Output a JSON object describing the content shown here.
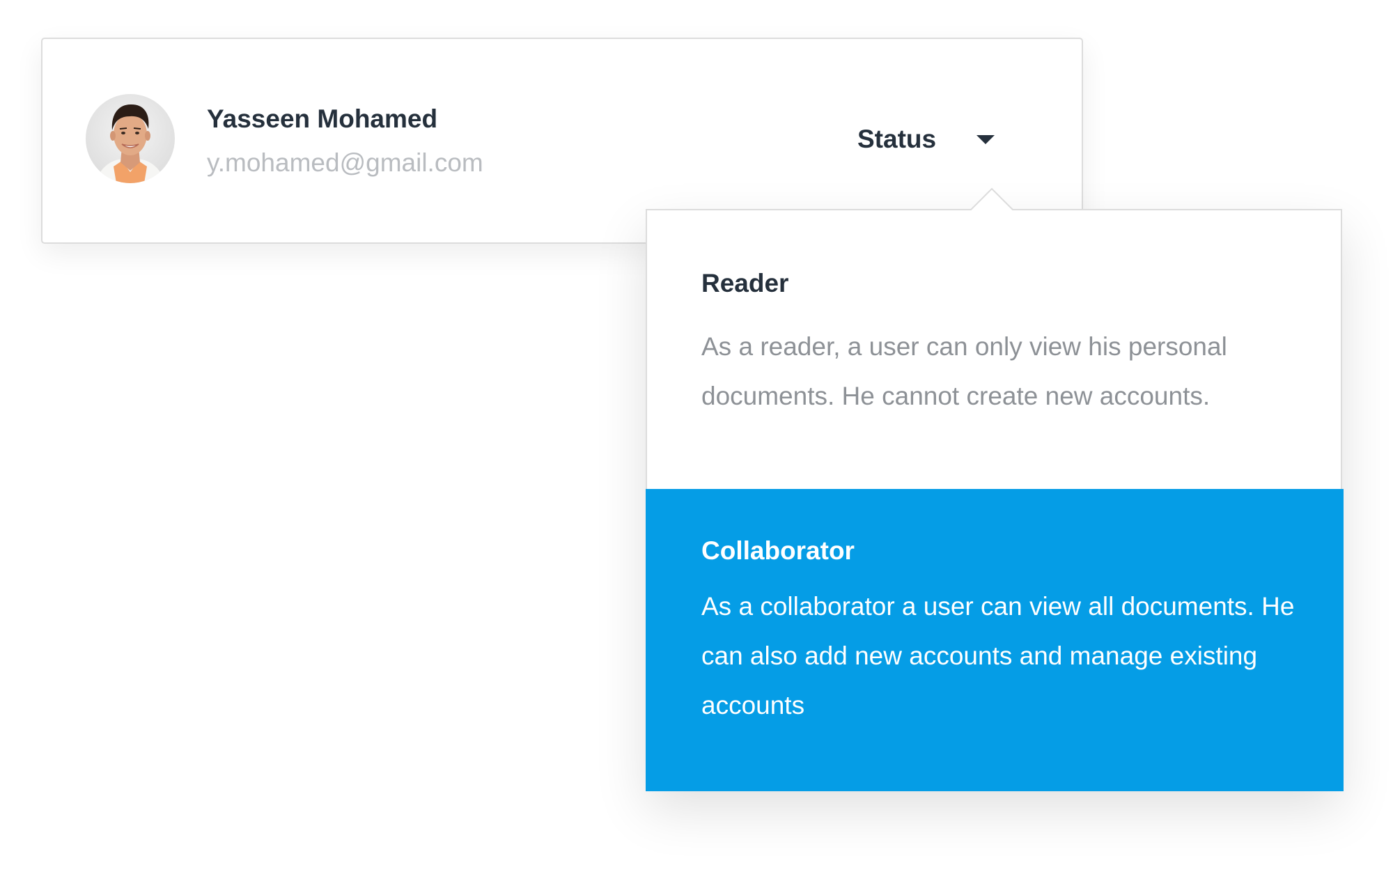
{
  "user": {
    "name": "Yasseen Mohamed",
    "email": "y.mohamed@gmail.com"
  },
  "status": {
    "label": "Status",
    "icon": "caret-down-icon"
  },
  "options": [
    {
      "title": "Reader",
      "description": "As a reader, a user can only view his personal documents. He cannot create new accounts.",
      "selected": false
    },
    {
      "title": "Collaborator",
      "description": "As a collaborator a user can view all documents. He can also add new accounts and manage existing accounts",
      "selected": true
    }
  ],
  "colors": {
    "accent": "#059de6",
    "text_dark": "#25303c",
    "text_muted": "#8d9196",
    "text_light": "#b9bcc0",
    "border": "#dcdcdc"
  }
}
